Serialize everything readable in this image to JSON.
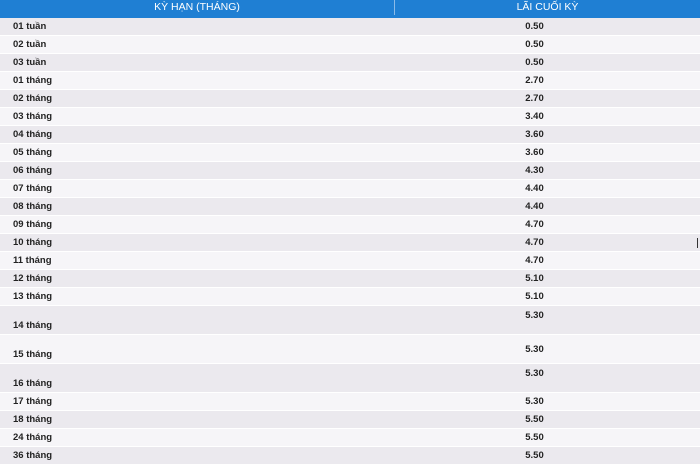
{
  "table": {
    "headers": {
      "term": "KỲ HẠN (THÁNG)",
      "rate": "LÃI CUỐI KỲ"
    },
    "rows": [
      {
        "term": "01 tuần",
        "rate": "0.50"
      },
      {
        "term": "02 tuần",
        "rate": "0.50"
      },
      {
        "term": "03 tuần",
        "rate": "0.50"
      },
      {
        "term": "01 tháng",
        "rate": "2.70"
      },
      {
        "term": "02 tháng",
        "rate": "2.70"
      },
      {
        "term": "03 tháng",
        "rate": "3.40"
      },
      {
        "term": "04 tháng",
        "rate": "3.60"
      },
      {
        "term": "05 tháng",
        "rate": "3.60"
      },
      {
        "term": "06 tháng",
        "rate": "4.30"
      },
      {
        "term": "07 tháng",
        "rate": "4.40"
      },
      {
        "term": "08 tháng",
        "rate": "4.40"
      },
      {
        "term": "09 tháng",
        "rate": "4.70"
      },
      {
        "term": "10 tháng",
        "rate": "4.70"
      },
      {
        "term": "11 tháng",
        "rate": "4.70"
      },
      {
        "term": "12 tháng",
        "rate": "5.10"
      },
      {
        "term": "13 tháng",
        "rate": "5.10"
      },
      {
        "term": "14 tháng",
        "rate": "5.30"
      },
      {
        "term": "15 tháng",
        "rate": "5.30"
      },
      {
        "term": "16 tháng",
        "rate": "5.30"
      },
      {
        "term": "17 tháng",
        "rate": "5.30"
      },
      {
        "term": "18 tháng",
        "rate": "5.50"
      },
      {
        "term": "24 tháng",
        "rate": "5.50"
      },
      {
        "term": "36 tháng",
        "rate": "5.50"
      }
    ]
  },
  "colors": {
    "header_bg": "#1f7fd3",
    "row_odd": "#ebe9ee",
    "row_even": "#f6f5f8"
  }
}
